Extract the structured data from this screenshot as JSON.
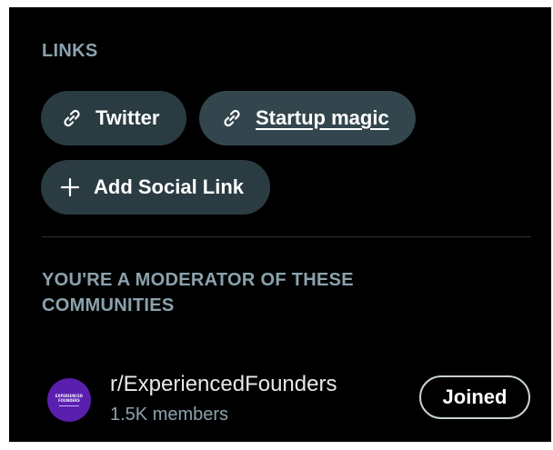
{
  "links": {
    "title": "LINKS",
    "items": [
      {
        "label": "Twitter",
        "icon": "link-icon"
      },
      {
        "label": "Startup magic",
        "icon": "link-icon"
      }
    ],
    "add_label": "Add Social Link",
    "add_icon": "plus-icon"
  },
  "moderator": {
    "title": "YOU'RE A MODERATOR OF THESE COMMUNITIES",
    "communities": [
      {
        "name": "r/ExperiencedFounders",
        "members": "1.5K members",
        "button_label": "Joined",
        "avatar_text": [
          "EXPERIENCED",
          "FOUNDERS"
        ]
      }
    ]
  },
  "colors": {
    "background": "#000000",
    "pill": "#2a3c42",
    "muted_text": "#8ba2ad",
    "avatar": "#5b1fb0"
  }
}
